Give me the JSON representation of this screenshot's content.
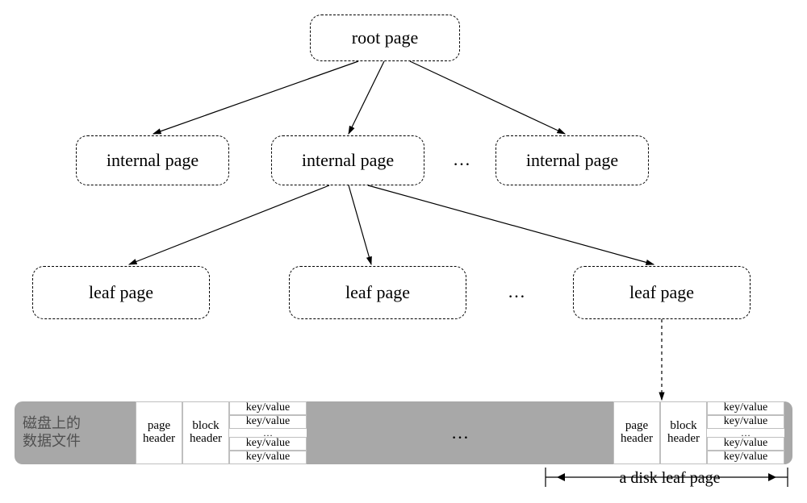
{
  "tree": {
    "root": "root page",
    "internal": [
      "internal page",
      "internal page",
      "internal page"
    ],
    "internal_ellipsis": "…",
    "leaves": [
      "leaf page",
      "leaf page",
      "leaf page"
    ],
    "leaf_ellipsis": "…"
  },
  "disk": {
    "file_label_line1": "磁盘上的",
    "file_label_line2": "数据文件",
    "page_header": "page header",
    "block_header": "block header",
    "kv": "key/value",
    "mid_ellipsis": "…",
    "kv_dots": "…",
    "leafpage_label": "a disk leaf page"
  }
}
